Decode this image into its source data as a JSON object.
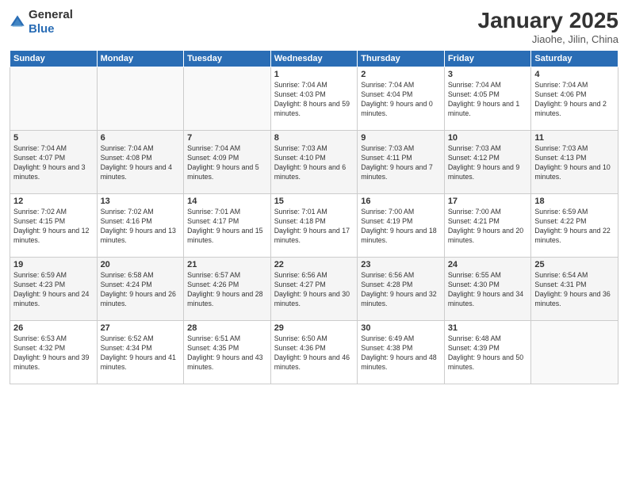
{
  "header": {
    "logo_general": "General",
    "logo_blue": "Blue",
    "title": "January 2025",
    "location": "Jiaohe, Jilin, China"
  },
  "weekdays": [
    "Sunday",
    "Monday",
    "Tuesday",
    "Wednesday",
    "Thursday",
    "Friday",
    "Saturday"
  ],
  "weeks": [
    [
      {
        "day": "",
        "text": ""
      },
      {
        "day": "",
        "text": ""
      },
      {
        "day": "",
        "text": ""
      },
      {
        "day": "1",
        "text": "Sunrise: 7:04 AM\nSunset: 4:03 PM\nDaylight: 8 hours and 59 minutes."
      },
      {
        "day": "2",
        "text": "Sunrise: 7:04 AM\nSunset: 4:04 PM\nDaylight: 9 hours and 0 minutes."
      },
      {
        "day": "3",
        "text": "Sunrise: 7:04 AM\nSunset: 4:05 PM\nDaylight: 9 hours and 1 minute."
      },
      {
        "day": "4",
        "text": "Sunrise: 7:04 AM\nSunset: 4:06 PM\nDaylight: 9 hours and 2 minutes."
      }
    ],
    [
      {
        "day": "5",
        "text": "Sunrise: 7:04 AM\nSunset: 4:07 PM\nDaylight: 9 hours and 3 minutes."
      },
      {
        "day": "6",
        "text": "Sunrise: 7:04 AM\nSunset: 4:08 PM\nDaylight: 9 hours and 4 minutes."
      },
      {
        "day": "7",
        "text": "Sunrise: 7:04 AM\nSunset: 4:09 PM\nDaylight: 9 hours and 5 minutes."
      },
      {
        "day": "8",
        "text": "Sunrise: 7:03 AM\nSunset: 4:10 PM\nDaylight: 9 hours and 6 minutes."
      },
      {
        "day": "9",
        "text": "Sunrise: 7:03 AM\nSunset: 4:11 PM\nDaylight: 9 hours and 7 minutes."
      },
      {
        "day": "10",
        "text": "Sunrise: 7:03 AM\nSunset: 4:12 PM\nDaylight: 9 hours and 9 minutes."
      },
      {
        "day": "11",
        "text": "Sunrise: 7:03 AM\nSunset: 4:13 PM\nDaylight: 9 hours and 10 minutes."
      }
    ],
    [
      {
        "day": "12",
        "text": "Sunrise: 7:02 AM\nSunset: 4:15 PM\nDaylight: 9 hours and 12 minutes."
      },
      {
        "day": "13",
        "text": "Sunrise: 7:02 AM\nSunset: 4:16 PM\nDaylight: 9 hours and 13 minutes."
      },
      {
        "day": "14",
        "text": "Sunrise: 7:01 AM\nSunset: 4:17 PM\nDaylight: 9 hours and 15 minutes."
      },
      {
        "day": "15",
        "text": "Sunrise: 7:01 AM\nSunset: 4:18 PM\nDaylight: 9 hours and 17 minutes."
      },
      {
        "day": "16",
        "text": "Sunrise: 7:00 AM\nSunset: 4:19 PM\nDaylight: 9 hours and 18 minutes."
      },
      {
        "day": "17",
        "text": "Sunrise: 7:00 AM\nSunset: 4:21 PM\nDaylight: 9 hours and 20 minutes."
      },
      {
        "day": "18",
        "text": "Sunrise: 6:59 AM\nSunset: 4:22 PM\nDaylight: 9 hours and 22 minutes."
      }
    ],
    [
      {
        "day": "19",
        "text": "Sunrise: 6:59 AM\nSunset: 4:23 PM\nDaylight: 9 hours and 24 minutes."
      },
      {
        "day": "20",
        "text": "Sunrise: 6:58 AM\nSunset: 4:24 PM\nDaylight: 9 hours and 26 minutes."
      },
      {
        "day": "21",
        "text": "Sunrise: 6:57 AM\nSunset: 4:26 PM\nDaylight: 9 hours and 28 minutes."
      },
      {
        "day": "22",
        "text": "Sunrise: 6:56 AM\nSunset: 4:27 PM\nDaylight: 9 hours and 30 minutes."
      },
      {
        "day": "23",
        "text": "Sunrise: 6:56 AM\nSunset: 4:28 PM\nDaylight: 9 hours and 32 minutes."
      },
      {
        "day": "24",
        "text": "Sunrise: 6:55 AM\nSunset: 4:30 PM\nDaylight: 9 hours and 34 minutes."
      },
      {
        "day": "25",
        "text": "Sunrise: 6:54 AM\nSunset: 4:31 PM\nDaylight: 9 hours and 36 minutes."
      }
    ],
    [
      {
        "day": "26",
        "text": "Sunrise: 6:53 AM\nSunset: 4:32 PM\nDaylight: 9 hours and 39 minutes."
      },
      {
        "day": "27",
        "text": "Sunrise: 6:52 AM\nSunset: 4:34 PM\nDaylight: 9 hours and 41 minutes."
      },
      {
        "day": "28",
        "text": "Sunrise: 6:51 AM\nSunset: 4:35 PM\nDaylight: 9 hours and 43 minutes."
      },
      {
        "day": "29",
        "text": "Sunrise: 6:50 AM\nSunset: 4:36 PM\nDaylight: 9 hours and 46 minutes."
      },
      {
        "day": "30",
        "text": "Sunrise: 6:49 AM\nSunset: 4:38 PM\nDaylight: 9 hours and 48 minutes."
      },
      {
        "day": "31",
        "text": "Sunrise: 6:48 AM\nSunset: 4:39 PM\nDaylight: 9 hours and 50 minutes."
      },
      {
        "day": "",
        "text": ""
      }
    ]
  ]
}
